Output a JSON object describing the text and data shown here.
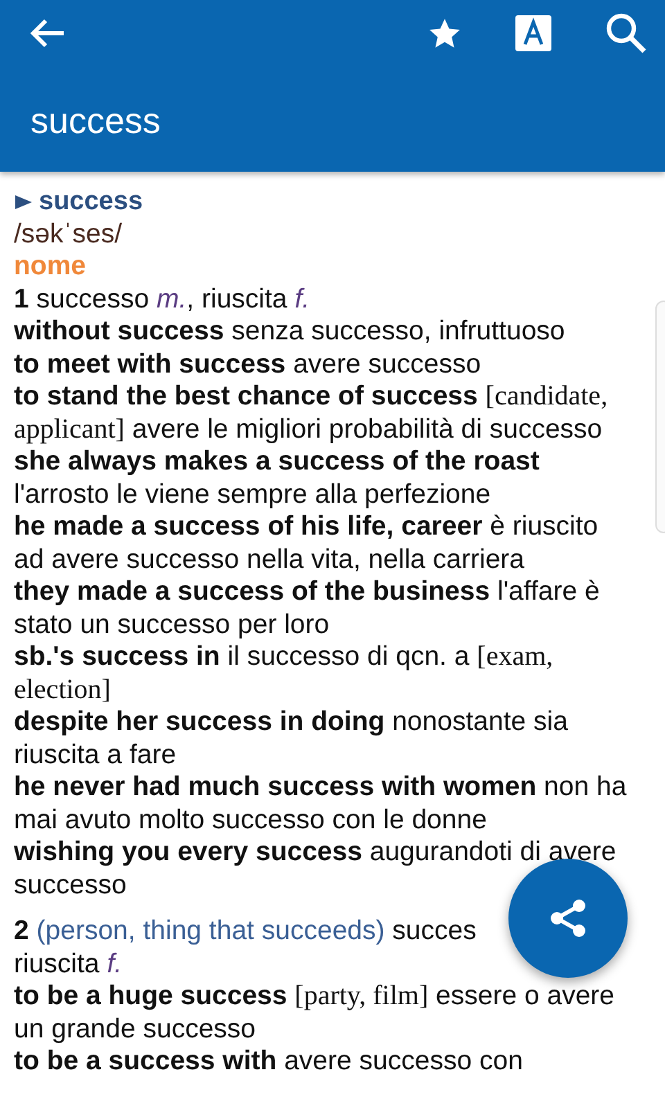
{
  "app_bar": {
    "title": "success"
  },
  "entry": {
    "headword": "success",
    "pronunciation": "/səkˈses/",
    "part_of_speech": "nome",
    "lines": [
      {
        "kind": "sense",
        "segments": [
          {
            "kind": "num",
            "text": "1"
          },
          {
            "kind": "plain",
            "text": " successo "
          },
          {
            "kind": "gram",
            "text": "m."
          },
          {
            "kind": "plain",
            "text": ", riuscita "
          },
          {
            "kind": "gram",
            "text": "f."
          }
        ]
      },
      {
        "kind": "example",
        "segments": [
          {
            "kind": "bold",
            "text": "without success"
          },
          {
            "kind": "plain",
            "text": " senza successo, infruttuoso"
          }
        ]
      },
      {
        "kind": "example",
        "segments": [
          {
            "kind": "bold",
            "text": "to meet with success"
          },
          {
            "kind": "plain",
            "text": " avere successo"
          }
        ]
      },
      {
        "kind": "example",
        "segments": [
          {
            "kind": "bold",
            "text": "to stand the best chance of success "
          },
          {
            "kind": "context",
            "text": "[candidate, applicant]"
          },
          {
            "kind": "plain",
            "text": " avere le migliori probabilità di successo"
          }
        ]
      },
      {
        "kind": "example",
        "segments": [
          {
            "kind": "bold",
            "text": "she always makes a success of the roast"
          },
          {
            "kind": "plain",
            "text": " l'arrosto le viene sempre alla perfezione"
          }
        ]
      },
      {
        "kind": "example",
        "segments": [
          {
            "kind": "bold",
            "text": "he made a success of his life, career"
          },
          {
            "kind": "plain",
            "text": " è riuscito ad avere successo nella vita, nella carriera"
          }
        ]
      },
      {
        "kind": "example",
        "segments": [
          {
            "kind": "bold",
            "text": "they made a success of the business"
          },
          {
            "kind": "plain",
            "text": " l'affare è stato un successo per loro"
          }
        ]
      },
      {
        "kind": "example",
        "segments": [
          {
            "kind": "bold",
            "text": "sb.'s success in"
          },
          {
            "kind": "plain",
            "text": " il successo di qcn. a "
          },
          {
            "kind": "context",
            "text": "[exam, election]"
          }
        ]
      },
      {
        "kind": "example",
        "segments": [
          {
            "kind": "bold",
            "text": "despite her success in doing"
          },
          {
            "kind": "plain",
            "text": " nonostante sia riuscita a fare"
          }
        ]
      },
      {
        "kind": "example",
        "segments": [
          {
            "kind": "bold",
            "text": "he never had much success with women"
          },
          {
            "kind": "plain",
            "text": " non ha mai avuto molto successo con le donne"
          }
        ]
      },
      {
        "kind": "example",
        "segments": [
          {
            "kind": "bold",
            "text": "wishing you every success"
          },
          {
            "kind": "plain",
            "text": " augurandoti di avere successo"
          }
        ]
      },
      {
        "kind": "sense",
        "segments": [
          {
            "kind": "num",
            "text": "2"
          },
          {
            "kind": "note",
            "text": " (person, thing that succeeds)"
          },
          {
            "kind": "plain",
            "text": " succes"
          },
          {
            "kind": "plain",
            "text": " riuscita "
          },
          {
            "kind": "gram",
            "text": "f."
          }
        ]
      },
      {
        "kind": "example",
        "segments": [
          {
            "kind": "bold",
            "text": "to be a huge success "
          },
          {
            "kind": "context",
            "text": "[party, film]"
          },
          {
            "kind": "plain",
            "text": " essere o avere un grande successo"
          }
        ]
      },
      {
        "kind": "example",
        "segments": [
          {
            "kind": "bold",
            "text": "to be a success with"
          },
          {
            "kind": "plain",
            "text": " avere successo con"
          }
        ]
      }
    ]
  }
}
